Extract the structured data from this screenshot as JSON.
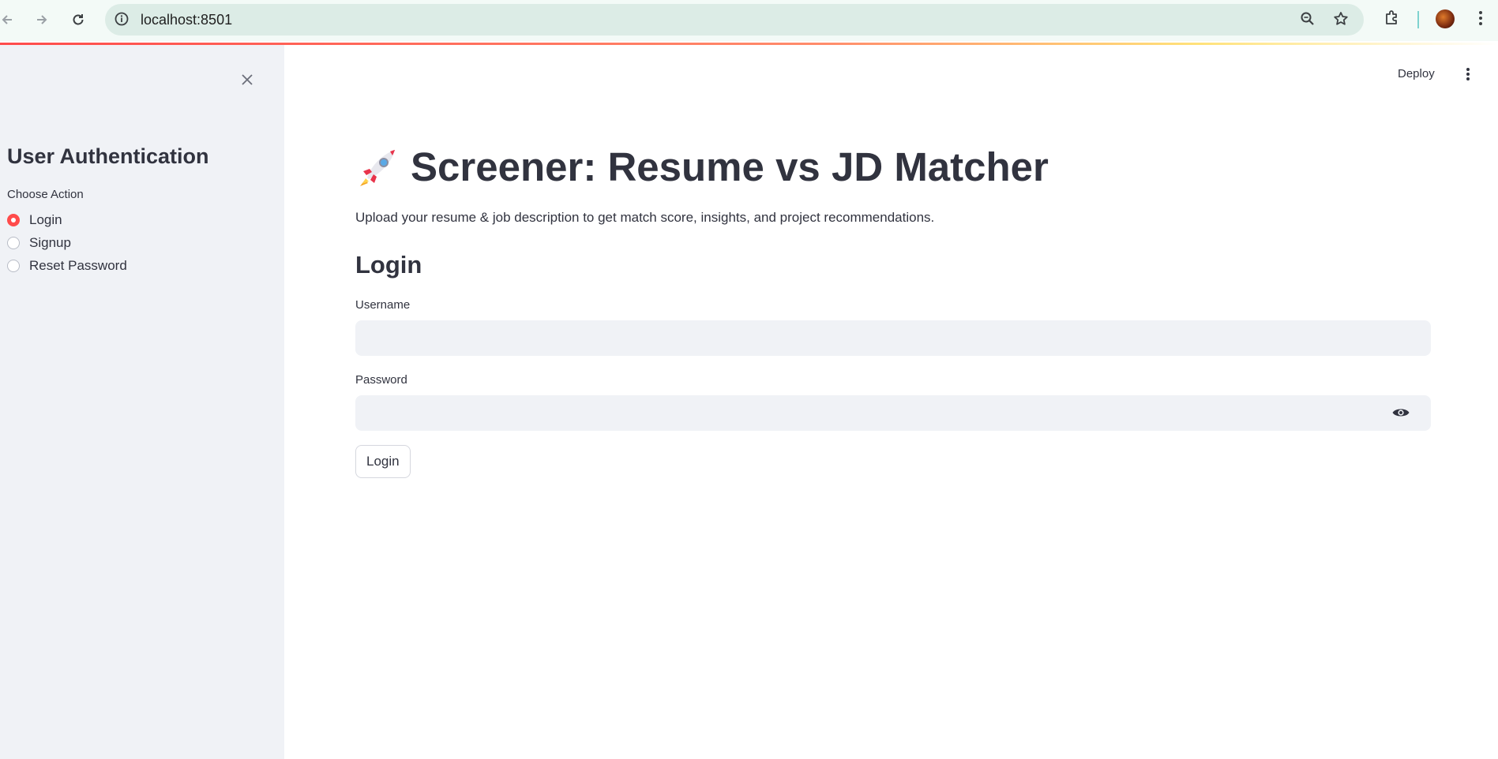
{
  "browser": {
    "url": "localhost:8501"
  },
  "sidebar": {
    "title": "User Authentication",
    "choose_label": "Choose Action",
    "options": [
      {
        "label": "Login",
        "selected": true
      },
      {
        "label": "Signup",
        "selected": false
      },
      {
        "label": "Reset Password",
        "selected": false
      }
    ]
  },
  "header": {
    "deploy_label": "Deploy"
  },
  "main": {
    "title": "Screener: Resume vs JD Matcher",
    "subtitle": "Upload your resume & job description to get match score, insights, and project recommendations.",
    "section_title": "Login",
    "username_label": "Username",
    "username_value": "",
    "password_label": "Password",
    "password_value": "",
    "login_button": "Login"
  },
  "colors": {
    "accent": "#ff4b4b",
    "sidebar_bg": "#f0f2f6",
    "text": "#31333f"
  }
}
